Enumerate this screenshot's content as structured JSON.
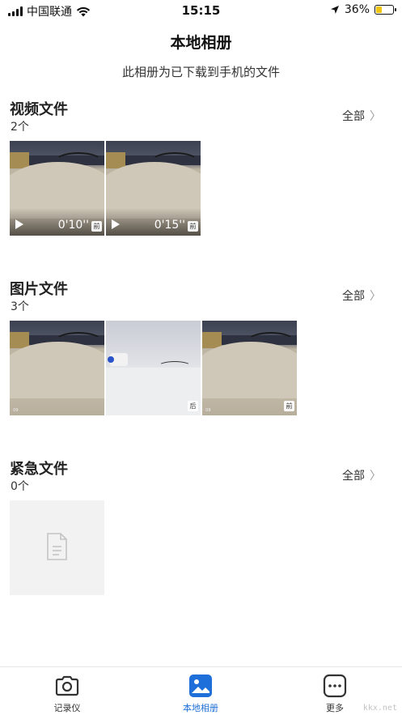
{
  "status_bar": {
    "carrier": "中国联通",
    "time": "15:15",
    "battery_percent": "36%",
    "battery_level": 0.36
  },
  "header": {
    "title": "本地相册",
    "subtitle": "此相册为已下载到手机的文件"
  },
  "sections": [
    {
      "title": "视频文件",
      "count": "2个",
      "all_label": "全部",
      "items": [
        {
          "duration": "0'10''",
          "camera": "前"
        },
        {
          "duration": "0'15''",
          "camera": "前"
        }
      ]
    },
    {
      "title": "图片文件",
      "count": "3个",
      "all_label": "全部",
      "items": [
        {
          "camera": ""
        },
        {
          "camera": "后"
        },
        {
          "camera": "前"
        }
      ]
    },
    {
      "title": "紧急文件",
      "count": "0个",
      "all_label": "全部",
      "items": []
    }
  ],
  "tabbar": {
    "tabs": [
      {
        "label": "记录仪",
        "icon": "camera-icon",
        "active": false
      },
      {
        "label": "本地相册",
        "icon": "album-icon",
        "active": true
      },
      {
        "label": "更多",
        "icon": "more-icon",
        "active": false
      }
    ],
    "active_color": "#1e6fd9"
  },
  "watermark": {
    "text": "kkx.net"
  }
}
